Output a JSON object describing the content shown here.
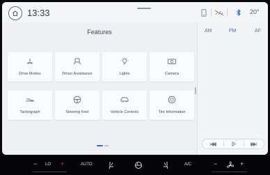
{
  "status_bar": {
    "time": "13:33",
    "temperature": "20°"
  },
  "features": {
    "title": "Features",
    "tiles": [
      {
        "label": "Drive Modes",
        "icon": "drive-modes-icon"
      },
      {
        "label": "Driver Assistance",
        "icon": "driver-assistance-icon"
      },
      {
        "label": "Lights",
        "icon": "lights-icon"
      },
      {
        "label": "Camera",
        "icon": "camera-icon"
      },
      {
        "label": "Tachograph",
        "icon": "tachograph-icon"
      },
      {
        "label": "Steering Feel",
        "icon": "steering-wheel-icon"
      },
      {
        "label": "Vehicle Controls",
        "icon": "vehicle-controls-icon"
      },
      {
        "label": "Tire Information",
        "icon": "tire-icon"
      }
    ],
    "page_count": 2,
    "current_page": 1
  },
  "audio": {
    "bands": [
      "AM",
      "FM",
      "AF"
    ],
    "selected_band": "FM",
    "controls": [
      "seek-back",
      "play",
      "seek-forward"
    ]
  },
  "climate": {
    "left_temp_minus": "−",
    "left_temp_value": "LO",
    "left_temp_plus": "+",
    "auto_label": "AUTO",
    "ac_label": "A/C",
    "fan_minus": "−",
    "fan_plus": "+"
  },
  "colors": {
    "accent": "#2b6fd6",
    "warm": "#d0382d"
  }
}
